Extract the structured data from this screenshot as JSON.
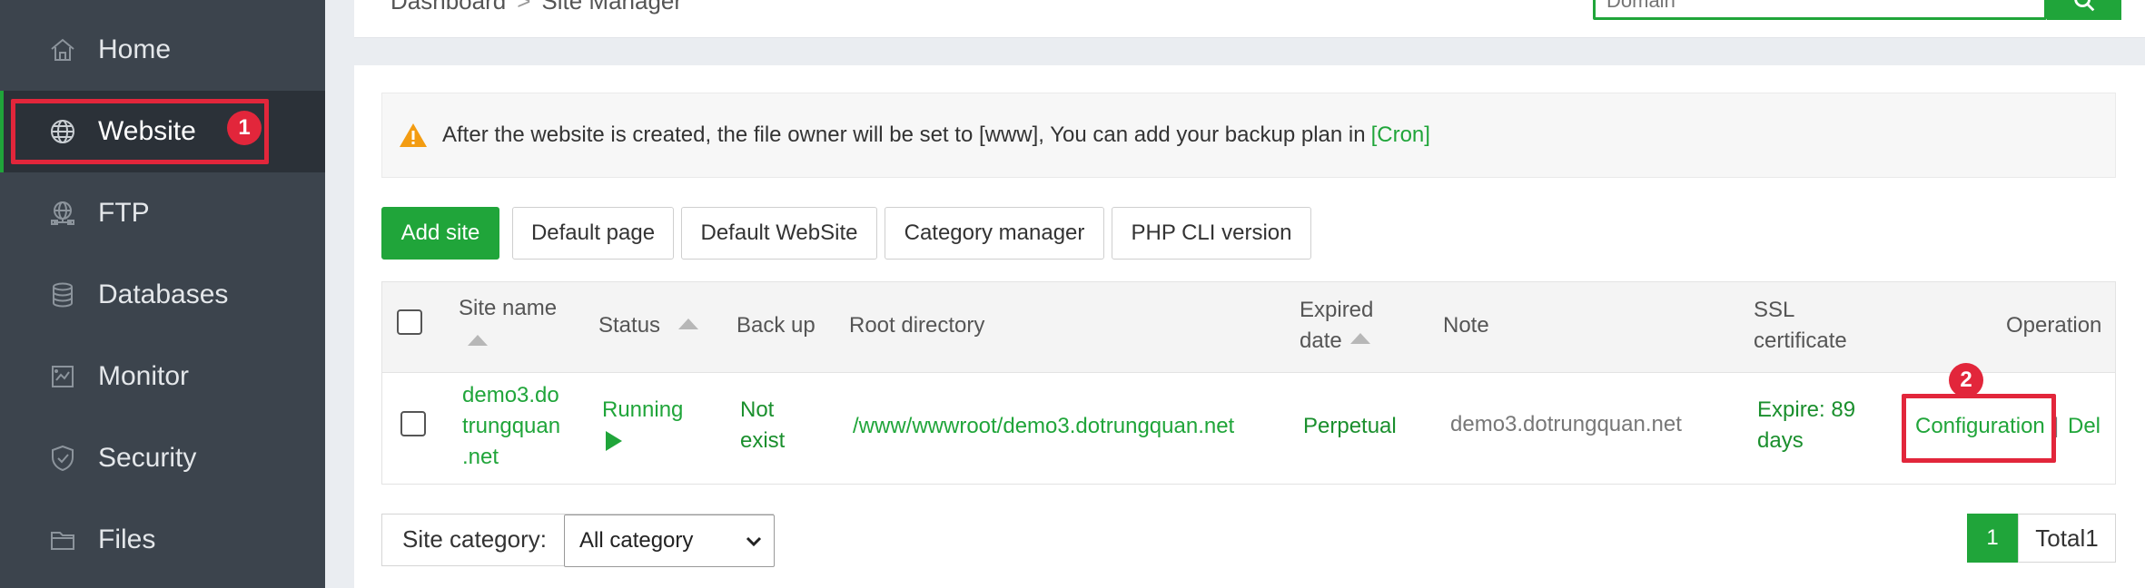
{
  "sidebar": {
    "items": [
      {
        "label": "Home",
        "icon": "home-icon"
      },
      {
        "label": "Website",
        "icon": "globe-icon",
        "active": true
      },
      {
        "label": "FTP",
        "icon": "ftp-icon"
      },
      {
        "label": "Databases",
        "icon": "database-icon"
      },
      {
        "label": "Monitor",
        "icon": "monitor-icon"
      },
      {
        "label": "Security",
        "icon": "shield-icon"
      },
      {
        "label": "Files",
        "icon": "folder-icon"
      }
    ]
  },
  "callouts": {
    "one": "1",
    "two": "2"
  },
  "header": {
    "breadcrumb": [
      "Dashboard",
      "Site Manager"
    ],
    "breadcrumb_sep": ">",
    "search_placeholder": "Domain"
  },
  "notice": {
    "text": "After the website is created, the file owner will be set to [www], You can add your backup plan in",
    "link": "[Cron]"
  },
  "toolbar": {
    "add_site": "Add site",
    "default_page": "Default page",
    "default_website": "Default WebSite",
    "category_manager": "Category manager",
    "php_cli_version": "PHP CLI version"
  },
  "table": {
    "headers": {
      "site_name": "Site name",
      "status": "Status",
      "backup": "Back up",
      "root_directory": "Root directory",
      "expired_line1": "Expired",
      "expired_line2": "date",
      "note": "Note",
      "ssl_line1": "SSL",
      "ssl_line2": "certificate",
      "operation": "Operation"
    },
    "rows": [
      {
        "site_name_l1": "demo3.do",
        "site_name_l2": "trungquan",
        "site_name_l3": ".net",
        "status": "Running",
        "backup_l1": "Not",
        "backup_l2": "exist",
        "root_directory": "/www/wwwroot/demo3.dotrungquan.net",
        "expired": "Perpetual",
        "note": "demo3.dotrungquan.net",
        "ssl_l1": "Expire: 89",
        "ssl_l2": "days",
        "op_config": "Configuration",
        "op_sep": "|",
        "op_del": "Del"
      }
    ]
  },
  "footer": {
    "category_label": "Site category:",
    "category_value": "All category",
    "page_current": "1",
    "page_total": "Total1"
  },
  "colors": {
    "accent": "#20a53a",
    "sidebar_bg": "#3c444d",
    "callout": "#e2263b"
  }
}
